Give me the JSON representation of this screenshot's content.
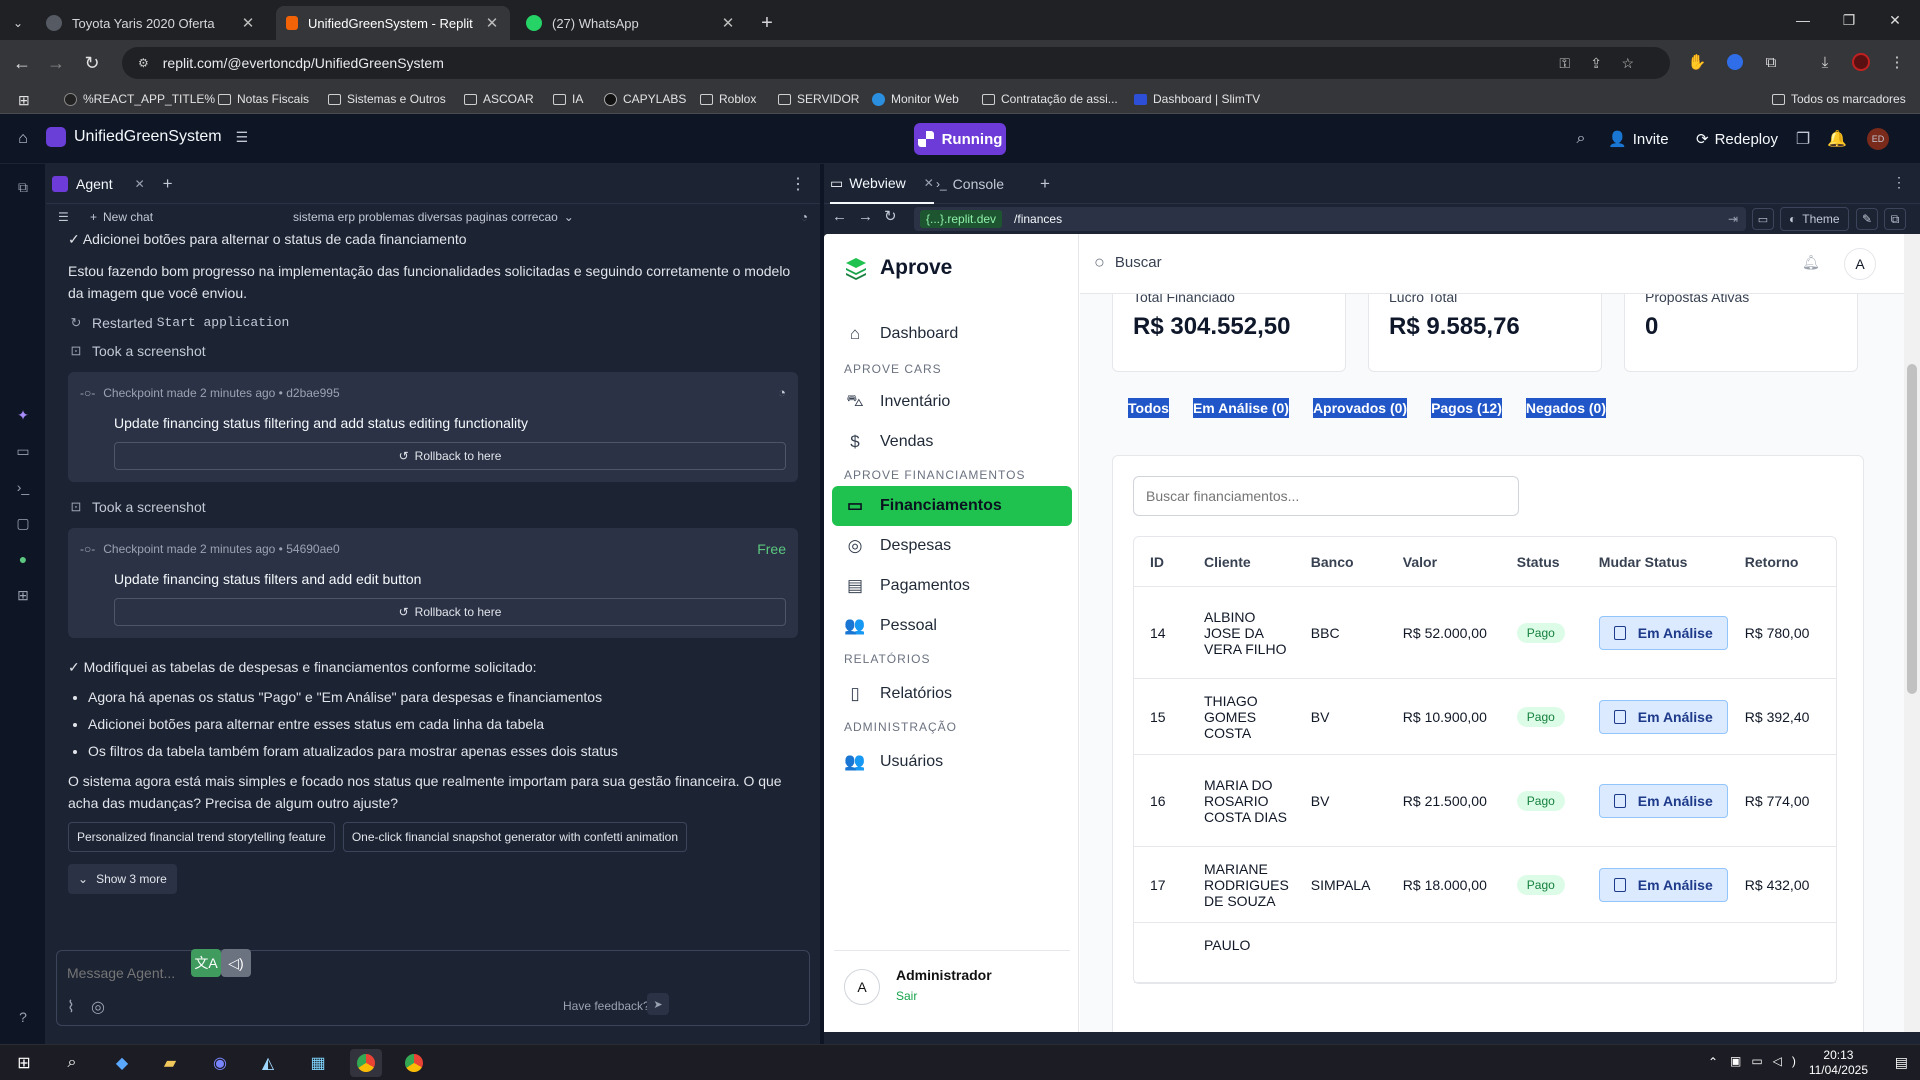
{
  "browser": {
    "tabs": [
      {
        "title": "Toyota Yaris 2020 Oferta",
        "active": false,
        "color": "#555a63"
      },
      {
        "title": "UnifiedGreenSystem - Replit",
        "active": true,
        "color": "#f26207"
      },
      {
        "title": "(27) WhatsApp",
        "active": false,
        "color": "#25d366"
      }
    ],
    "url": "replit.com/@evertoncdp/UnifiedGreenSystem",
    "bookmarks": [
      "%REACT_APP_TITLE%",
      "Notas Fiscais",
      "Sistemas e Outros",
      "ASCOAR",
      "IA",
      "CAPYLABS",
      "Roblox",
      "SERVIDOR",
      "Monitor Web",
      "Contratação de assi...",
      "Dashboard | SlimTV",
      "Todos os marcadores"
    ]
  },
  "replit": {
    "project_name": "UnifiedGreenSystem",
    "run_status": "Running",
    "invite_label": "Invite",
    "redeploy_label": "Redeploy",
    "avatar_initials": "ED"
  },
  "agent": {
    "tab_label": "Agent",
    "new_chat_label": "New chat",
    "chat_title": "sistema erp problemas diversas paginas correcao",
    "messages": {
      "line1": "✓ Adicionei botões para alternar o status de cada financiamento",
      "progress": "Estou fazendo bom progresso na implementação das funcionalidades solicitadas e seguindo corretamente o modelo da imagem que você enviou.",
      "restarted_prefix": "Restarted",
      "restarted_cmd": "Start application",
      "screenshot1": "Took a screenshot",
      "screenshot2": "Took a screenshot",
      "summary": "✓ Modifiquei as tabelas de despesas e financiamentos conforme solicitado:",
      "bullets": [
        "Agora há apenas os status \"Pago\" e \"Em Análise\" para despesas e financiamentos",
        "Adicionei botões para alternar entre esses status em cada linha da tabela",
        "Os filtros da tabela também foram atualizados para mostrar apenas esses dois status"
      ],
      "closing": "O sistema agora está mais simples e focado nos status que realmente importam para sua gestão financeira. O que acha das mudanças? Precisa de algum outro ajuste?"
    },
    "checkpoints": [
      {
        "meta": "Checkpoint made 2 minutes ago • d2bae995",
        "title": "Update financing status filtering and add status editing functionality",
        "rollback": "Rollback to here",
        "badge": ""
      },
      {
        "meta": "Checkpoint made 2 minutes ago • 54690ae0",
        "title": "Update financing status filters and add edit button",
        "rollback": "Rollback to here",
        "badge": "Free"
      }
    ],
    "suggestions": [
      "Personalized financial trend storytelling feature",
      "One-click financial snapshot generator with confetti animation"
    ],
    "show_more": "Show 3 more",
    "input_placeholder": "Message Agent...",
    "feedback": "Have feedback?"
  },
  "webview": {
    "tabs": [
      "Webview",
      "Console"
    ],
    "host": "{...}.replit.dev",
    "path": "/finances",
    "theme_label": "Theme"
  },
  "app": {
    "brand": "Aprove",
    "search_placeholder": "Buscar",
    "user_initial": "A",
    "nav": {
      "dashboard": "Dashboard",
      "section_cars": "APROVE CARS",
      "inventario": "Inventário",
      "vendas": "Vendas",
      "section_fin": "APROVE FINANCIAMENTOS",
      "financiamentos": "Financiamentos",
      "despesas": "Despesas",
      "pagamentos": "Pagamentos",
      "pessoal": "Pessoal",
      "section_rel": "RELATÓRIOS",
      "relatorios": "Relatórios",
      "section_admin": "ADMINISTRAÇÃO",
      "usuarios": "Usuários"
    },
    "user": {
      "name": "Administrador",
      "logout": "Sair",
      "initial": "A"
    },
    "stats": [
      {
        "label": "Total Financiado",
        "value": "R$ 304.552,50"
      },
      {
        "label": "Lucro Total",
        "value": "R$ 9.585,76"
      },
      {
        "label": "Propostas Ativas",
        "value": "0"
      }
    ],
    "filters": [
      "Todos",
      "Em Análise (0)",
      "Aprovados (0)",
      "Pagos (12)",
      "Negados (0)"
    ],
    "table_search_placeholder": "Buscar financiamentos...",
    "columns": [
      "ID",
      "Cliente",
      "Banco",
      "Valor",
      "Status",
      "Mudar Status",
      "Retorno"
    ],
    "rows": [
      {
        "id": "14",
        "cliente": "ALBINO JOSE DA VERA FILHO",
        "banco": "BBC",
        "valor": "R$ 52.000,00",
        "status": "Pago",
        "action": "Em Análise",
        "retorno": "R$ 780,00"
      },
      {
        "id": "15",
        "cliente": "THIAGO GOMES COSTA",
        "banco": "BV",
        "valor": "R$ 10.900,00",
        "status": "Pago",
        "action": "Em Análise",
        "retorno": "R$ 392,40"
      },
      {
        "id": "16",
        "cliente": "MARIA DO ROSARIO COSTA DIAS",
        "banco": "BV",
        "valor": "R$ 21.500,00",
        "status": "Pago",
        "action": "Em Análise",
        "retorno": "R$ 774,00"
      },
      {
        "id": "17",
        "cliente": "MARIANE RODRIGUES DE SOUZA",
        "banco": "SIMPALA",
        "valor": "R$ 18.000,00",
        "status": "Pago",
        "action": "Em Análise",
        "retorno": "R$ 432,00"
      },
      {
        "id": "",
        "cliente": "PAULO",
        "banco": "",
        "valor": "",
        "status": "",
        "action": "",
        "retorno": ""
      }
    ]
  },
  "taskbar": {
    "time": "20:13",
    "date": "11/04/2025"
  }
}
